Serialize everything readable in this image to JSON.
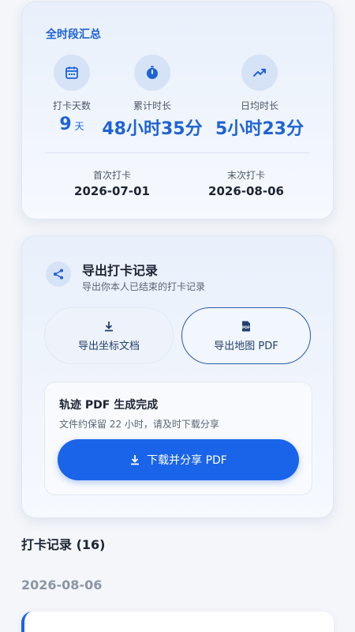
{
  "summary": {
    "title": "全时段汇总",
    "stats": [
      {
        "icon": "calendar-icon",
        "label": "打卡天数",
        "value": "9",
        "unit": "天"
      },
      {
        "icon": "stopwatch-icon",
        "label": "累计时长",
        "value": "48小时35分",
        "unit": ""
      },
      {
        "icon": "trend-up-icon",
        "label": "日均时长",
        "value": "5小时23分",
        "unit": ""
      }
    ],
    "first_checkin": {
      "label": "首次打卡",
      "value": "2026-07-01"
    },
    "last_checkin": {
      "label": "末次打卡",
      "value": "2026-08-06"
    }
  },
  "export": {
    "title": "导出打卡记录",
    "subtitle": "导出你本人已结束的打卡记录",
    "options": [
      {
        "label": "导出坐标文档",
        "icon": "download-icon"
      },
      {
        "label": "导出地图 PDF",
        "icon": "pdf-file-icon"
      }
    ],
    "result": {
      "title": "轨迹 PDF 生成完成",
      "subtitle": "文件约保留 22 小时，请及时下载分享",
      "button_label": "下载并分享 PDF"
    }
  },
  "records": {
    "title": "打卡记录 (16)",
    "groups": [
      {
        "date": "2026-08-06"
      }
    ]
  },
  "colors": {
    "accent": "#1e63d6",
    "button": "#1a64ea",
    "background": "#f4f6fa"
  }
}
